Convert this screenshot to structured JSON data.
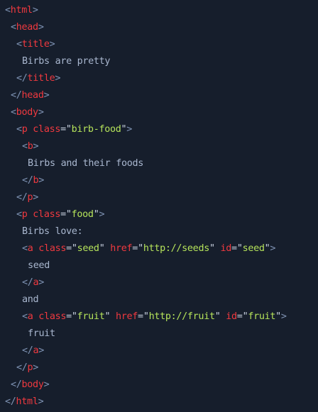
{
  "theme": {
    "background": "#161e2c",
    "tag": "#f0393f",
    "punct": "#7f93b4",
    "string": "#b5e35a",
    "text": "#a9b7cf"
  },
  "lines": [
    {
      "indent": 0,
      "tokens": [
        [
          "p",
          "<"
        ],
        [
          "t",
          "html"
        ],
        [
          "p",
          ">"
        ]
      ]
    },
    {
      "indent": 1,
      "tokens": [
        [
          "p",
          "<"
        ],
        [
          "t",
          "head"
        ],
        [
          "p",
          ">"
        ]
      ]
    },
    {
      "indent": 2,
      "tokens": [
        [
          "p",
          "<"
        ],
        [
          "t",
          "title"
        ],
        [
          "p",
          ">"
        ]
      ]
    },
    {
      "indent": 3,
      "tokens": [
        [
          "x",
          "Birbs are pretty"
        ]
      ]
    },
    {
      "indent": 2,
      "tokens": [
        [
          "p",
          "</"
        ],
        [
          "t",
          "title"
        ],
        [
          "p",
          ">"
        ]
      ]
    },
    {
      "indent": 1,
      "tokens": [
        [
          "p",
          "</"
        ],
        [
          "t",
          "head"
        ],
        [
          "p",
          ">"
        ]
      ]
    },
    {
      "indent": 1,
      "tokens": [
        [
          "p",
          "<"
        ],
        [
          "t",
          "body"
        ],
        [
          "p",
          ">"
        ]
      ]
    },
    {
      "indent": 2,
      "tokens": [
        [
          "p",
          "<"
        ],
        [
          "t",
          "p "
        ],
        [
          "a",
          "class"
        ],
        [
          "e",
          "="
        ],
        [
          "q",
          "\""
        ],
        [
          "s",
          "birb-food"
        ],
        [
          "q",
          "\""
        ],
        [
          "p",
          ">"
        ]
      ]
    },
    {
      "indent": 3,
      "tokens": [
        [
          "p",
          "<"
        ],
        [
          "t",
          "b"
        ],
        [
          "p",
          ">"
        ]
      ]
    },
    {
      "indent": 4,
      "tokens": [
        [
          "x",
          "Birbs and their foods"
        ]
      ]
    },
    {
      "indent": 3,
      "tokens": [
        [
          "p",
          "</"
        ],
        [
          "t",
          "b"
        ],
        [
          "p",
          ">"
        ]
      ]
    },
    {
      "indent": 2,
      "tokens": [
        [
          "p",
          "</"
        ],
        [
          "t",
          "p"
        ],
        [
          "p",
          ">"
        ]
      ]
    },
    {
      "indent": 2,
      "tokens": [
        [
          "p",
          "<"
        ],
        [
          "t",
          "p "
        ],
        [
          "a",
          "class"
        ],
        [
          "e",
          "="
        ],
        [
          "q",
          "\""
        ],
        [
          "s",
          "food"
        ],
        [
          "q",
          "\""
        ],
        [
          "p",
          ">"
        ]
      ]
    },
    {
      "indent": 3,
      "tokens": [
        [
          "x",
          "Birbs love:"
        ]
      ]
    },
    {
      "indent": 3,
      "tokens": [
        [
          "p",
          "<"
        ],
        [
          "t",
          "a "
        ],
        [
          "a",
          "class"
        ],
        [
          "e",
          "="
        ],
        [
          "q",
          "\""
        ],
        [
          "s",
          "seed"
        ],
        [
          "q",
          "\" "
        ],
        [
          "a",
          "href"
        ],
        [
          "e",
          "="
        ],
        [
          "q",
          "\""
        ],
        [
          "s",
          "http://seeds"
        ],
        [
          "q",
          "\" "
        ],
        [
          "a",
          "id"
        ],
        [
          "e",
          "="
        ],
        [
          "q",
          "\""
        ],
        [
          "s",
          "seed"
        ],
        [
          "q",
          "\""
        ],
        [
          "p",
          ">"
        ]
      ]
    },
    {
      "indent": 4,
      "tokens": [
        [
          "x",
          "seed"
        ]
      ]
    },
    {
      "indent": 3,
      "tokens": [
        [
          "p",
          "</"
        ],
        [
          "t",
          "a"
        ],
        [
          "p",
          ">"
        ]
      ]
    },
    {
      "indent": 3,
      "tokens": [
        [
          "x",
          "and"
        ]
      ]
    },
    {
      "indent": 3,
      "tokens": [
        [
          "p",
          "<"
        ],
        [
          "t",
          "a "
        ],
        [
          "a",
          "class"
        ],
        [
          "e",
          "="
        ],
        [
          "q",
          "\""
        ],
        [
          "s",
          "fruit"
        ],
        [
          "q",
          "\" "
        ],
        [
          "a",
          "href"
        ],
        [
          "e",
          "="
        ],
        [
          "q",
          "\""
        ],
        [
          "s",
          "http://fruit"
        ],
        [
          "q",
          "\" "
        ],
        [
          "a",
          "id"
        ],
        [
          "e",
          "="
        ],
        [
          "q",
          "\""
        ],
        [
          "s",
          "fruit"
        ],
        [
          "q",
          "\""
        ],
        [
          "p",
          ">"
        ]
      ]
    },
    {
      "indent": 4,
      "tokens": [
        [
          "x",
          "fruit"
        ]
      ]
    },
    {
      "indent": 3,
      "tokens": [
        [
          "p",
          "</"
        ],
        [
          "t",
          "a"
        ],
        [
          "p",
          ">"
        ]
      ]
    },
    {
      "indent": 2,
      "tokens": [
        [
          "p",
          "</"
        ],
        [
          "t",
          "p"
        ],
        [
          "p",
          ">"
        ]
      ]
    },
    {
      "indent": 1,
      "tokens": [
        [
          "p",
          "</"
        ],
        [
          "t",
          "body"
        ],
        [
          "p",
          ">"
        ]
      ]
    },
    {
      "indent": 0,
      "tokens": [
        [
          "p",
          "</"
        ],
        [
          "t",
          "html"
        ],
        [
          "p",
          ">"
        ]
      ]
    }
  ]
}
